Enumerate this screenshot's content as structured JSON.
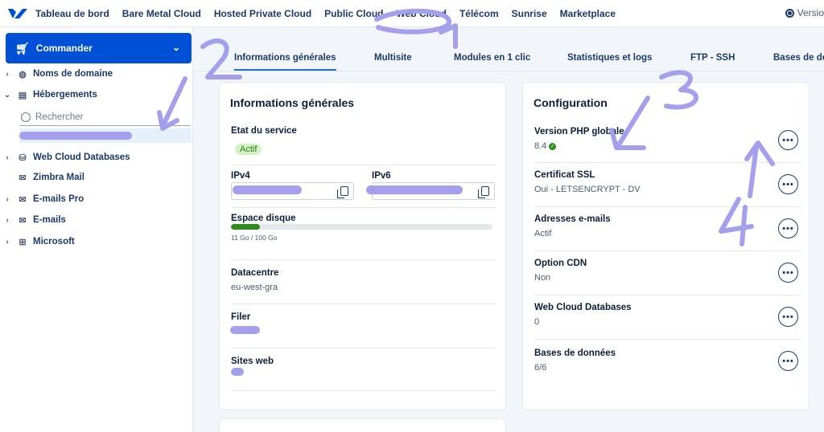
{
  "topnav": {
    "items": [
      "Tableau de bord",
      "Bare Metal Cloud",
      "Hosted Private Cloud",
      "Public Cloud",
      "Web Cloud",
      "Télécom",
      "Sunrise",
      "Marketplace"
    ],
    "version_label": "Versio"
  },
  "sidebar": {
    "order_button": "Commander",
    "items": [
      {
        "label": "Noms de domaine",
        "icon": "globe-icon"
      },
      {
        "label": "Hébergements",
        "icon": "hosting-icon"
      },
      {
        "label": "Web Cloud Databases",
        "icon": "database-icon"
      },
      {
        "label": "Zimbra Mail",
        "icon": "mail-icon"
      },
      {
        "label": "E-mails Pro",
        "icon": "mail-icon"
      },
      {
        "label": "E-mails",
        "icon": "mail-icon"
      },
      {
        "label": "Microsoft",
        "icon": "windows-icon"
      }
    ],
    "search_placeholder": "Rechercher"
  },
  "tabs": [
    "Informations générales",
    "Multisite",
    "Modules en 1 clic",
    "Statistiques et logs",
    "FTP - SSH",
    "Bases de do"
  ],
  "general": {
    "title": "Informations générales",
    "service_state_label": "Etat du service",
    "service_state_value": "Actif",
    "ipv4_label": "IPv4",
    "ipv6_label": "IPv6",
    "disk_label": "Espace disque",
    "disk_usage_text": "11 Go / 100 Go",
    "disk_used_fraction": 0.11,
    "datacenter_label": "Datacentre",
    "datacenter_value": "eu-west-gra",
    "filer_label": "Filer",
    "sites_label": "Sites web"
  },
  "config": {
    "title": "Configuration",
    "rows": [
      {
        "label": "Version PHP globale",
        "value": "8.4"
      },
      {
        "label": "Certificat SSL",
        "value": "Oui - LETSENCRYPT - DV"
      },
      {
        "label": "Adresses e-mails",
        "value": "Actif"
      },
      {
        "label": "Option CDN",
        "value": "Non"
      },
      {
        "label": "Web Cloud Databases",
        "value": "0"
      },
      {
        "label": "Bases de données",
        "value": "6/6"
      }
    ]
  },
  "annotations": [
    "1",
    "2",
    "3",
    "4"
  ],
  "colors": {
    "accent": "#0050d7",
    "annotation": "#a4a0ec",
    "success": "#2e8b1d"
  }
}
